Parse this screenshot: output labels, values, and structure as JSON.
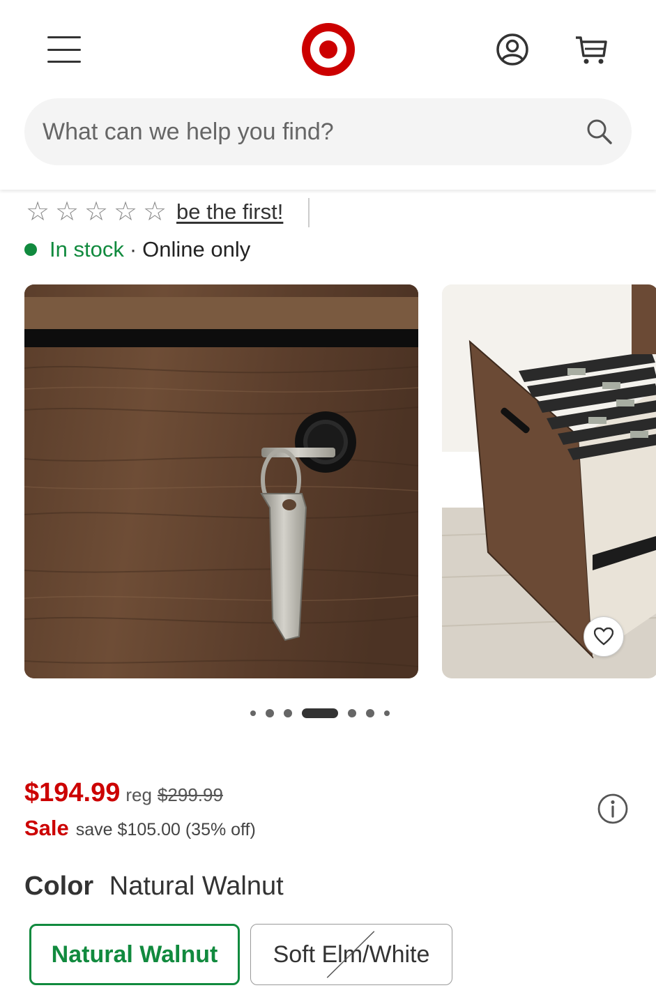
{
  "header": {
    "menu_icon": "hamburger-icon",
    "logo_icon": "target-bullseye-logo",
    "account_icon": "account-icon",
    "cart_icon": "cart-icon"
  },
  "search": {
    "placeholder": "What can we help you find?",
    "icon": "search-icon"
  },
  "rating": {
    "stars_filled": 0,
    "stars_total": 5,
    "link_text": "be the first!"
  },
  "stock": {
    "status": "In stock",
    "separator": "·",
    "availability": "Online only"
  },
  "carousel": {
    "images": [
      {
        "alt": "walnut drawer with key in lock"
      },
      {
        "alt": "open file drawer with hanging folders"
      }
    ],
    "dot_count": 7,
    "active_index": 3,
    "favorite_icon": "heart-icon"
  },
  "price": {
    "current": "$194.99",
    "reg_label": "reg",
    "original": "$299.99",
    "sale_label": "Sale",
    "savings": "save $105.00 (35% off)",
    "info_icon": "info-icon"
  },
  "color": {
    "label": "Color",
    "selected": "Natural Walnut",
    "options": [
      {
        "label": "Natural Walnut",
        "selected": true,
        "available": true
      },
      {
        "label": "Soft Elm/White",
        "selected": false,
        "available": false
      }
    ]
  },
  "colors": {
    "brand_red": "#cc0000",
    "in_stock_green": "#118a3e"
  }
}
